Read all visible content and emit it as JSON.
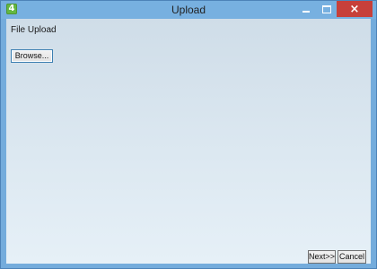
{
  "window": {
    "title": "Upload",
    "app_icon_glyph": "4",
    "app_icon_color": "#64b842",
    "controls": {
      "minimize_icon": "minimize-icon",
      "maximize_icon": "maximize-icon",
      "close_glyph": "×",
      "close_color": "#c7403a"
    }
  },
  "content": {
    "section_title": "File Upload",
    "browse_label": "Browse..."
  },
  "footer": {
    "next_label": "Next>>",
    "cancel_label": "Cancel"
  }
}
